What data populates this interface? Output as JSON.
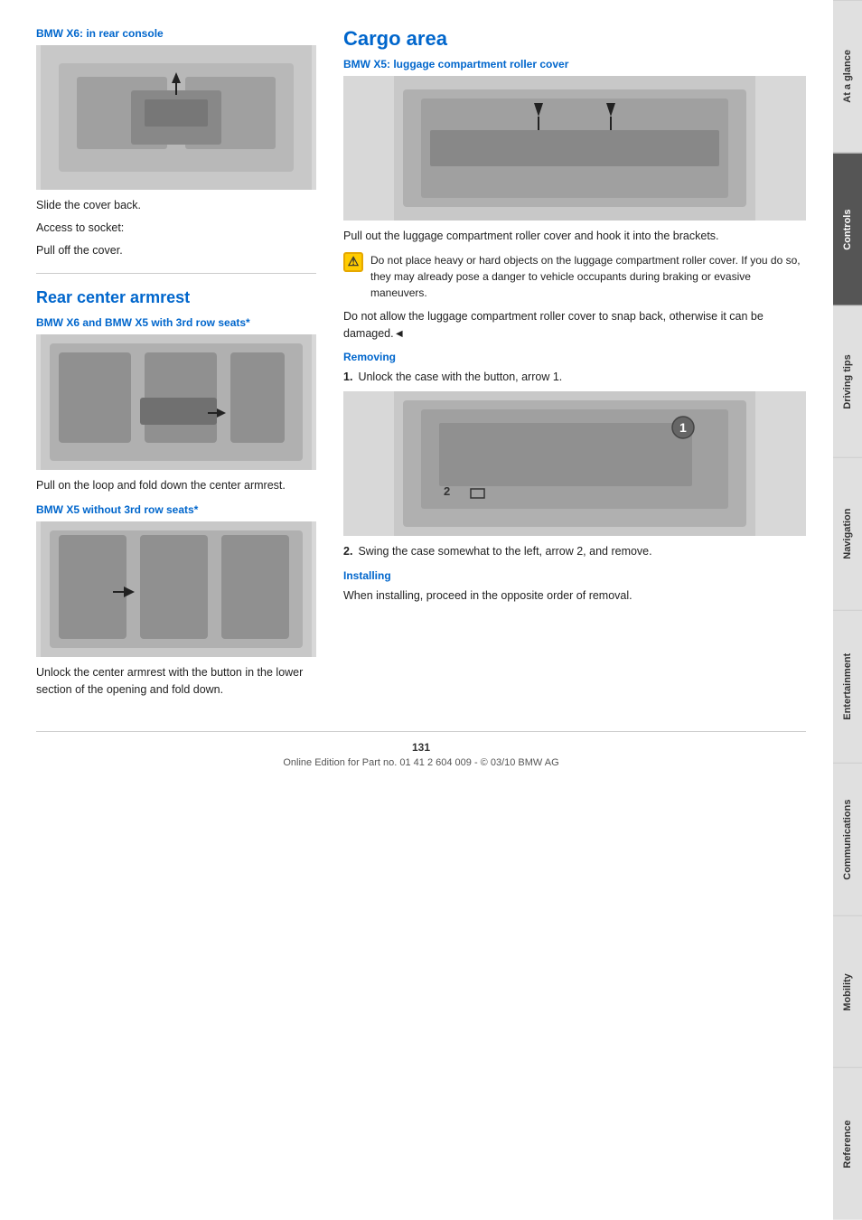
{
  "page": {
    "number": "131",
    "footer": "Online Edition for Part no. 01 41 2 604 009 - © 03/10 BMW AG"
  },
  "side_tabs": [
    {
      "label": "At a glance",
      "active": false
    },
    {
      "label": "Controls",
      "active": true
    },
    {
      "label": "Driving tips",
      "active": false
    },
    {
      "label": "Navigation",
      "active": false
    },
    {
      "label": "Entertainment",
      "active": false
    },
    {
      "label": "Communications",
      "active": false
    },
    {
      "label": "Mobility",
      "active": false
    },
    {
      "label": "Reference",
      "active": false
    }
  ],
  "left_col": {
    "section1": {
      "label": "BMW X6: in rear console",
      "text1": "Slide the cover back.",
      "text2": "Access to socket:",
      "text3": "Pull off the cover."
    },
    "section2": {
      "heading": "Rear center armrest",
      "sub1": {
        "label": "BMW X6 and BMW X5 with 3rd row seats*",
        "text": "Pull on the loop and fold down the center armrest."
      },
      "sub2": {
        "label": "BMW X5 without 3rd row seats*",
        "text": "Unlock the center armrest with the button in the lower section of the opening and fold down."
      }
    }
  },
  "right_col": {
    "heading": "Cargo area",
    "section1": {
      "label": "BMW X5: luggage compartment roller cover",
      "text1": "Pull out the luggage compartment roller cover and hook it into the brackets.",
      "warning": "Do not place heavy or hard objects on the luggage compartment roller cover. If you do so, they may already pose a danger to vehicle occupants during braking or evasive maneuvers.",
      "text2": "Do not allow the luggage compartment roller cover to snap back, otherwise it can be damaged.◄"
    },
    "section2": {
      "label": "Removing",
      "steps": [
        {
          "num": "1.",
          "text": "Unlock the case with the button, arrow 1."
        },
        {
          "num": "2.",
          "text": "Swing the case somewhat to the left, arrow 2, and remove."
        }
      ]
    },
    "section3": {
      "label": "Installing",
      "text": "When installing, proceed in the opposite order of removal."
    }
  }
}
